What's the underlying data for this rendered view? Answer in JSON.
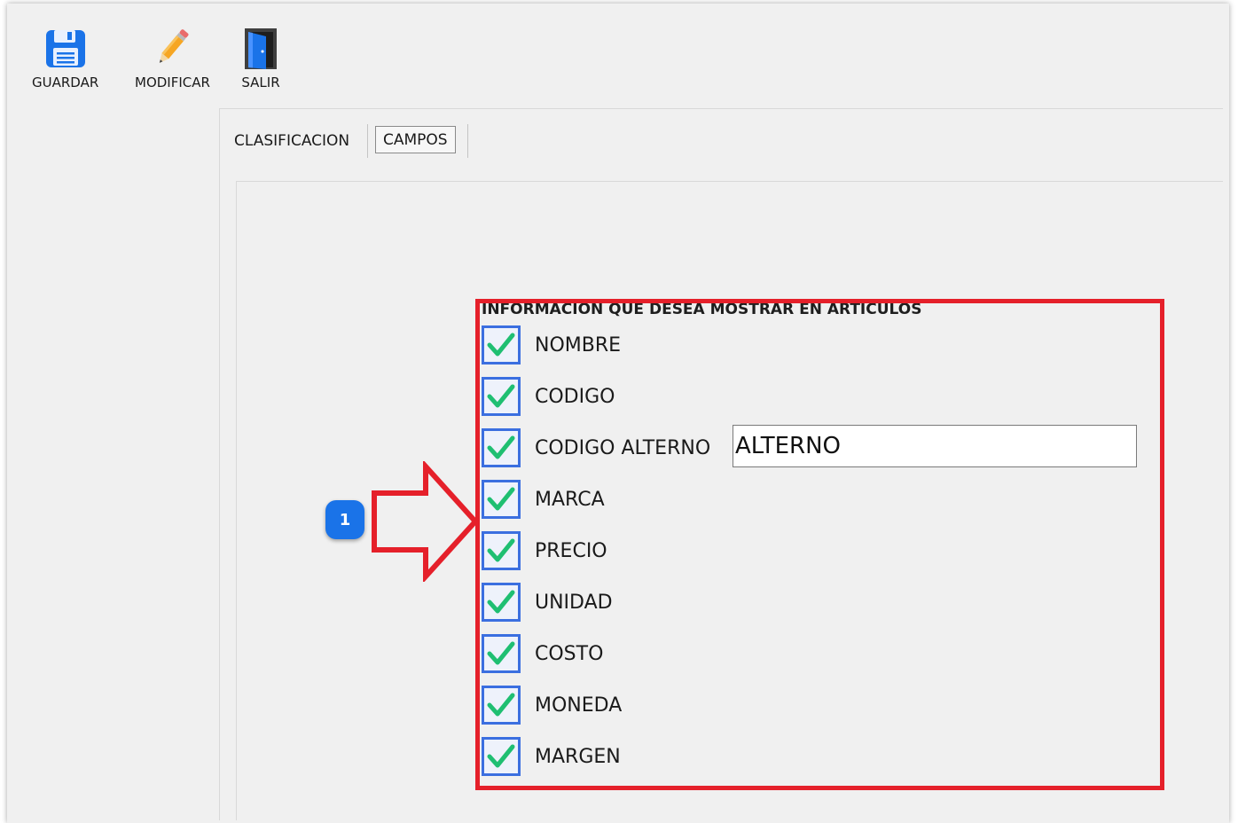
{
  "toolbar": {
    "save_label": "GUARDAR",
    "edit_label": "MODIFICAR",
    "exit_label": "SALIR"
  },
  "tabs": [
    {
      "label": "CLASIFICACION",
      "active": false
    },
    {
      "label": "CAMPOS",
      "active": true
    }
  ],
  "fields_group": {
    "title": "INFORMACION QUE DESEA MOSTRAR EN ARTICULOS",
    "items": [
      {
        "label": "NOMBRE",
        "checked": true
      },
      {
        "label": "CODIGO",
        "checked": true
      },
      {
        "label": "CODIGO ALTERNO",
        "checked": true
      },
      {
        "label": "MARCA",
        "checked": true
      },
      {
        "label": "PRECIO",
        "checked": true
      },
      {
        "label": "UNIDAD",
        "checked": true
      },
      {
        "label": "COSTO",
        "checked": true
      },
      {
        "label": "MONEDA",
        "checked": true
      },
      {
        "label": "MARGEN",
        "checked": true
      }
    ],
    "alt_code_value": "ALTERNO"
  },
  "annotation": {
    "badge_number": "1",
    "highlight_color": "#e5202a",
    "badge_color": "#1a73e8"
  },
  "colors": {
    "checkbox_border": "#3b6fe0",
    "checkmark": "#1fbf72"
  }
}
